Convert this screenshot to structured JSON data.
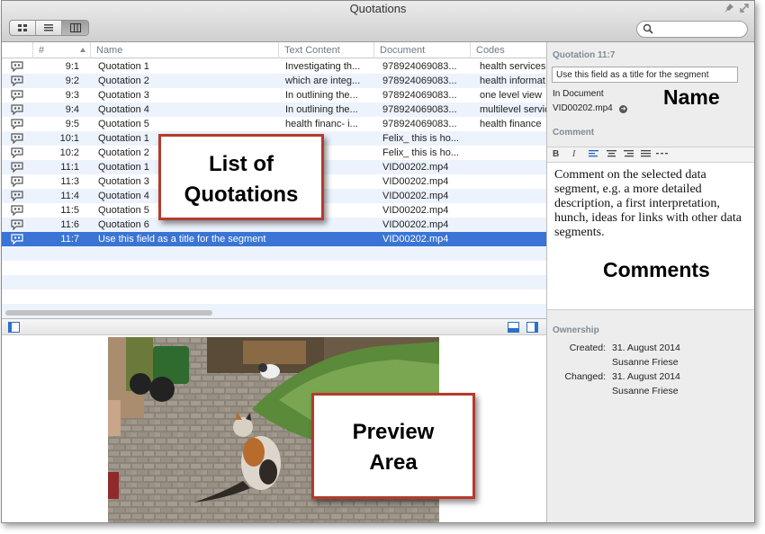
{
  "window": {
    "title": "Quotations"
  },
  "toolbar": {
    "view_buttons": [
      "icon-view-icon",
      "list-view-icon",
      "column-view-icon"
    ],
    "search_placeholder": ""
  },
  "table": {
    "columns": [
      "#",
      "Name",
      "Text Content",
      "Document",
      "Codes"
    ],
    "rows": [
      {
        "num": "9:1",
        "name": "Quotation 1",
        "text": "Investigating th...",
        "doc": "978924069083...",
        "codes": "health services"
      },
      {
        "num": "9:2",
        "name": "Quotation 2",
        "text": "which are integ...",
        "doc": "978924069083...",
        "codes": "health informat"
      },
      {
        "num": "9:3",
        "name": "Quotation 3",
        "text": "In outlining the...",
        "doc": "978924069083...",
        "codes": "one level view"
      },
      {
        "num": "9:4",
        "name": "Quotation 4",
        "text": "In outlining the...",
        "doc": "978924069083...",
        "codes": "multilevel servic"
      },
      {
        "num": "9:5",
        "name": "Quotation 5",
        "text": "health financ- i...",
        "doc": "978924069083...",
        "codes": "health finance"
      },
      {
        "num": "10:1",
        "name": "Quotation 1",
        "text": "",
        "doc": "Felix_ this is ho...",
        "codes": ""
      },
      {
        "num": "10:2",
        "name": "Quotation 2",
        "text": "",
        "doc": "Felix_ this is ho...",
        "codes": ""
      },
      {
        "num": "11:1",
        "name": "Quotation 1",
        "text": "",
        "doc": "VID00202.mp4",
        "codes": ""
      },
      {
        "num": "11:3",
        "name": "Quotation 3",
        "text": "",
        "doc": "VID00202.mp4",
        "codes": ""
      },
      {
        "num": "11:4",
        "name": "Quotation 4",
        "text": "",
        "doc": "VID00202.mp4",
        "codes": ""
      },
      {
        "num": "11:5",
        "name": "Quotation 5",
        "text": "",
        "doc": "VID00202.mp4",
        "codes": ""
      },
      {
        "num": "11:6",
        "name": "Quotation 6",
        "text": "",
        "doc": "VID00202.mp4",
        "codes": ""
      },
      {
        "num": "11:7",
        "name": "Use this field as a title for the segment",
        "text": "",
        "doc": "VID00202.mp4",
        "codes": "",
        "selected": true
      }
    ]
  },
  "right_panel": {
    "quotation_header": "Quotation 11:7",
    "name_value": "Use this field as a title for the segment",
    "in_document_label": "In Document",
    "in_document_value": "VID00202.mp4",
    "comment_header": "Comment",
    "format_buttons": [
      "B",
      "I"
    ],
    "comment_text": "Comment on the selected data segment, e.g. a more detailed description, a first interpretation, hunch, ideas for links with other data segments.",
    "ownership_header": "Ownership",
    "created_label": "Created:",
    "created_date": "31. August 2014",
    "created_by": "Susanne Friese",
    "changed_label": "Changed:",
    "changed_date": "31. August 2014",
    "changed_by": "Susanne Friese"
  },
  "annotations": {
    "list_line1": "List of",
    "list_line2": "Quotations",
    "preview_line1": "Preview",
    "preview_line2": "Area",
    "name_label": "Name",
    "comments_label": "Comments"
  },
  "colors": {
    "selection": "#3a74d4",
    "alt_row": "#edf3fd",
    "callout_border": "#b63a2b",
    "section_header": "#808b96"
  }
}
